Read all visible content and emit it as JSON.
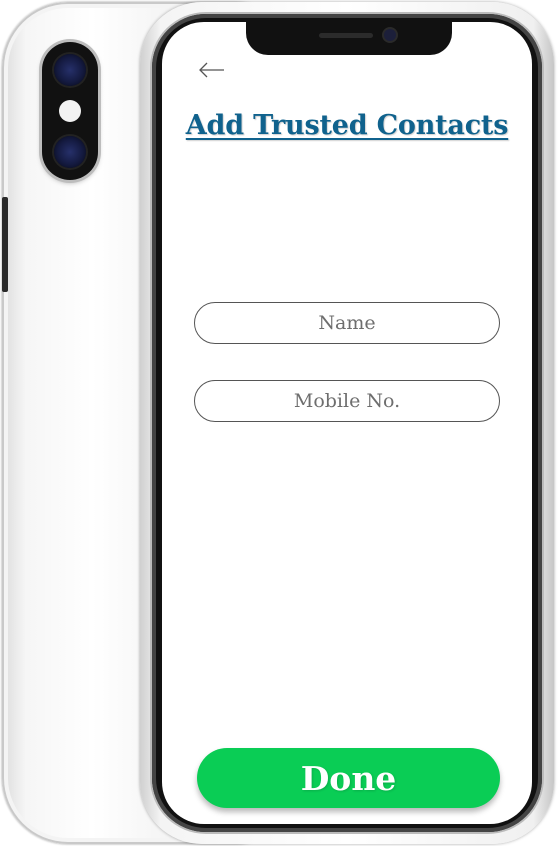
{
  "screen": {
    "title": "Add Trusted Contacts",
    "back_icon": "arrow-left-icon"
  },
  "form": {
    "name_placeholder": "Name",
    "name_value": "",
    "mobile_placeholder": "Mobile No.",
    "mobile_value": ""
  },
  "actions": {
    "done_label": "Done"
  },
  "colors": {
    "title": "#10628d",
    "done_button": "#0acd55",
    "done_text": "#ffffff"
  }
}
